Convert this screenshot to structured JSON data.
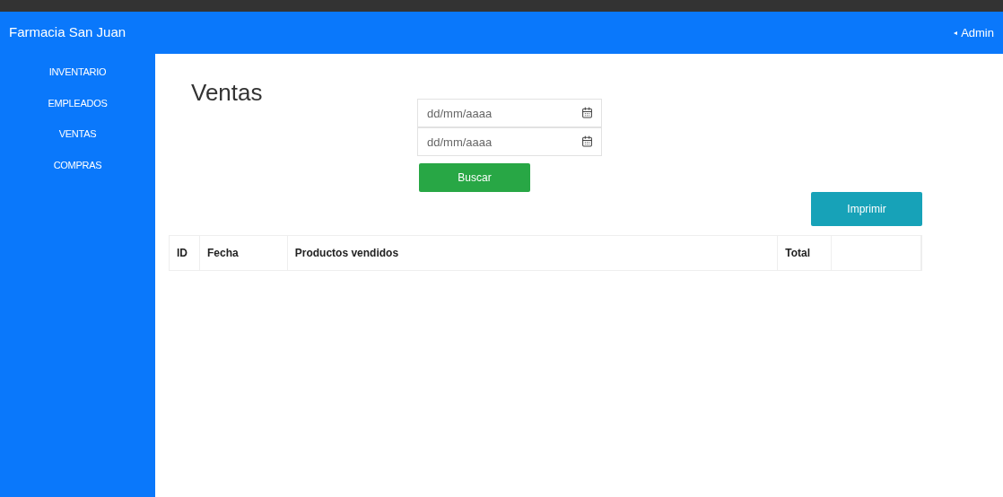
{
  "header": {
    "brand": "Farmacia San Juan",
    "user_caret": "◂",
    "user": "Admin"
  },
  "sidebar": {
    "items": [
      {
        "label": "INVENTARIO"
      },
      {
        "label": "EMPLEADOS"
      },
      {
        "label": "VENTAS"
      },
      {
        "label": "COMPRAS"
      }
    ]
  },
  "page": {
    "title": "Ventas",
    "date_fields": [
      {
        "placeholder": "dd/mm/aaaa"
      },
      {
        "placeholder": "dd/mm/aaaa"
      }
    ],
    "search_button": "Buscar",
    "print_button": "Imprimir"
  },
  "table": {
    "columns": [
      "ID",
      "Fecha",
      "Productos vendidos",
      "Total",
      ""
    ]
  }
}
